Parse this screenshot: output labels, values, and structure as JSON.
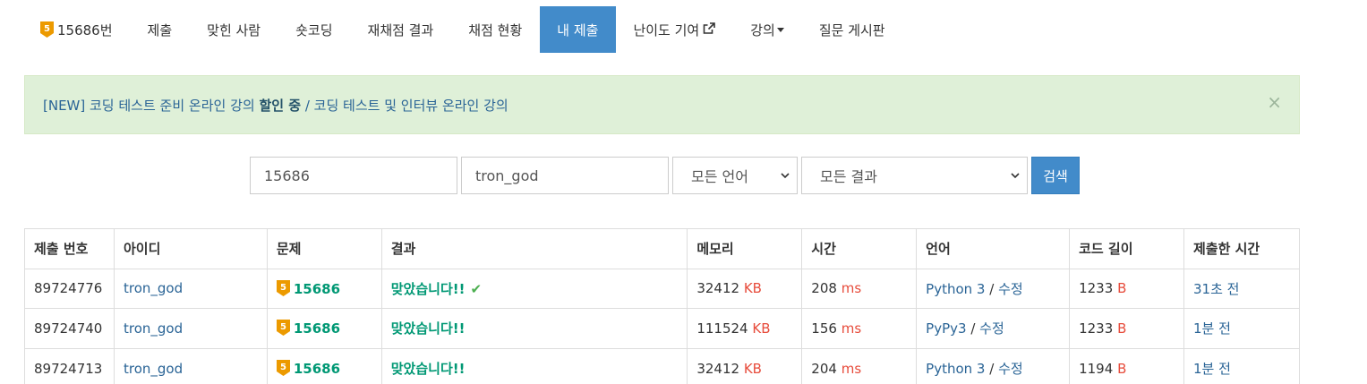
{
  "nav": {
    "problem_label": "15686번",
    "tier_number": "5",
    "items": [
      {
        "label": "제출"
      },
      {
        "label": "맞힌 사람"
      },
      {
        "label": "숏코딩"
      },
      {
        "label": "재채점 결과"
      },
      {
        "label": "채점 현황"
      },
      {
        "label": "내 제출"
      },
      {
        "label": "난이도 기여"
      },
      {
        "label": "강의"
      },
      {
        "label": "질문 게시판"
      }
    ]
  },
  "alert": {
    "prefix": "[NEW] 코딩 테스트 준비 온라인 강의 ",
    "bold": "할인 중",
    "suffix": " / 코딩 테스트 및 인터뷰 온라인 강의",
    "close": "×"
  },
  "search": {
    "problem_value": "15686",
    "user_value": "tron_god",
    "language_selected": "모든 언어",
    "result_selected": "모든 결과",
    "button_label": "검색"
  },
  "table": {
    "headers": [
      "제출 번호",
      "아이디",
      "문제",
      "결과",
      "메모리",
      "시간",
      "언어",
      "코드 길이",
      "제출한 시간"
    ],
    "units": {
      "memory": "KB",
      "time": "ms",
      "code": "B"
    },
    "edit_label": "수정",
    "rows": [
      {
        "id": "89724776",
        "user": "tron_god",
        "tier": "5",
        "problem": "15686",
        "result": "맞았습니다!!",
        "check": "✔",
        "memory": "32412",
        "time": "208",
        "language": "Python 3",
        "code_length": "1233",
        "submitted": "31초 전"
      },
      {
        "id": "89724740",
        "user": "tron_god",
        "tier": "5",
        "problem": "15686",
        "result": "맞았습니다!!",
        "check": "",
        "memory": "111524",
        "time": "156",
        "language": "PyPy3",
        "code_length": "1233",
        "submitted": "1분 전"
      },
      {
        "id": "89724713",
        "user": "tron_god",
        "tier": "5",
        "problem": "15686",
        "result": "맞았습니다!!",
        "check": "",
        "memory": "32412",
        "time": "204",
        "language": "Python 3",
        "code_length": "1194",
        "submitted": "1분 전"
      }
    ]
  },
  "colors": {
    "nav_active": "#428bca",
    "alert_bg": "#dff0d8",
    "accepted": "#009874",
    "unit": "#e74c3c",
    "link": "#2a6496",
    "tier_gold": "#ec9a00"
  }
}
